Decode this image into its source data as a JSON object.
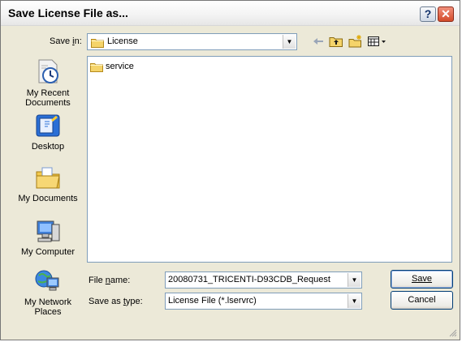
{
  "window": {
    "title": "Save License File as...",
    "help_label": "?",
    "close_label": "✕"
  },
  "toolbar": {
    "save_in_label": "Save in:",
    "save_in_value": "License",
    "back_icon": "back-arrow-icon",
    "up_icon": "up-one-level-icon",
    "new_folder_icon": "create-new-folder-icon",
    "views_icon": "views-menu-icon"
  },
  "places": [
    {
      "label": "My Recent Documents",
      "icon": "recent-documents-icon"
    },
    {
      "label": "Desktop",
      "icon": "desktop-icon"
    },
    {
      "label": "My Documents",
      "icon": "my-documents-icon"
    },
    {
      "label": "My Computer",
      "icon": "my-computer-icon"
    },
    {
      "label": "My Network Places",
      "icon": "network-places-icon"
    }
  ],
  "files": [
    {
      "name": "service",
      "type": "folder"
    }
  ],
  "form": {
    "file_name_label": "File name:",
    "file_name_value": "20080731_TRICENTI-D93CDB_Request",
    "save_type_label": "Save as type:",
    "save_type_value": "License File (*.lservrc)"
  },
  "buttons": {
    "save": "Save",
    "cancel": "Cancel"
  },
  "colors": {
    "dialog_bg": "#ece9d8",
    "field_border": "#7f9db9",
    "button_border": "#003c74",
    "close_red": "#d34b2a"
  }
}
